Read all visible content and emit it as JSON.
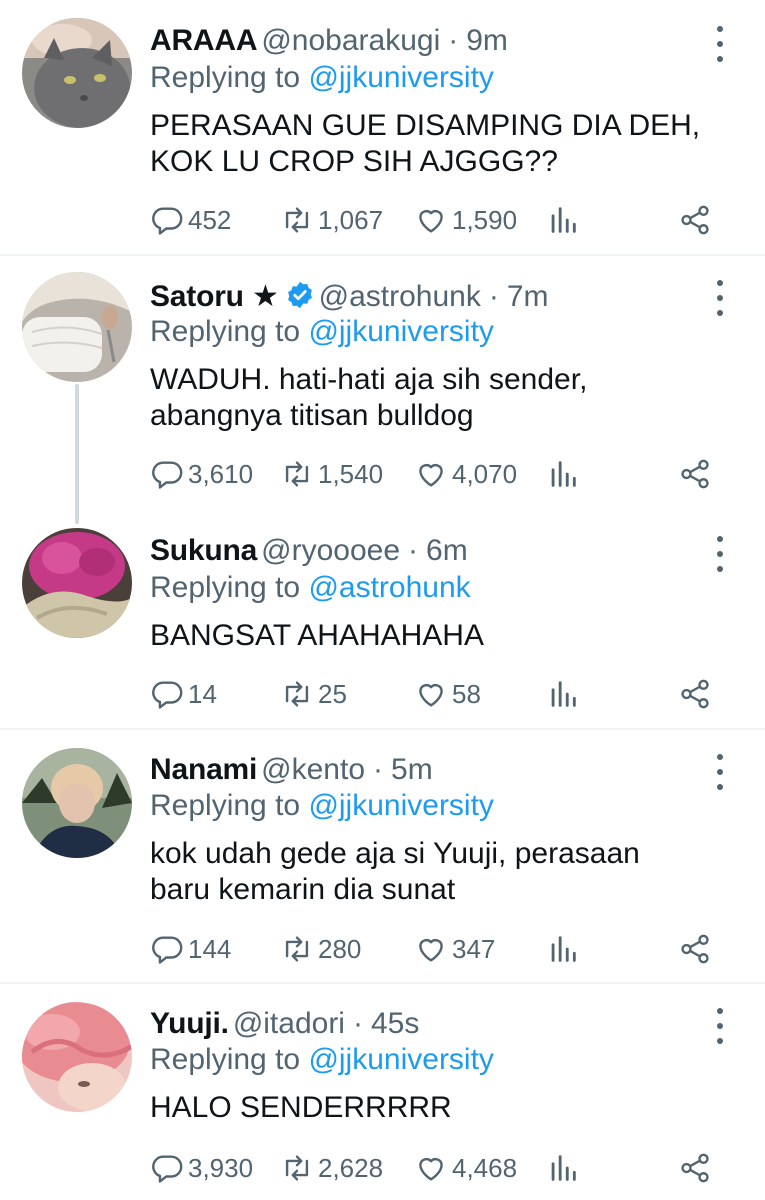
{
  "tweets": [
    {
      "name": "ARAAA",
      "handle": "@nobarakugi",
      "time": "9m",
      "reply_prefix": "Replying to",
      "reply_to": "@jjkuniversity",
      "text": "PERASAAN GUE DISAMPING DIA DEH,\nKOK LU CROP SIH AJGGG??",
      "replies": "452",
      "retweets": "1,067",
      "likes": "1,590"
    },
    {
      "name": "Satoru ★",
      "handle": "@astrohunk",
      "time": "7m",
      "reply_prefix": "Replying to",
      "reply_to": "@jjkuniversity",
      "text": "WADUH. hati-hati aja sih sender,\nabangnya titisan bulldog",
      "replies": "3,610",
      "retweets": "1,540",
      "likes": "4,070"
    },
    {
      "name": "Sukuna",
      "handle": "@ryoooee",
      "time": "6m",
      "reply_prefix": "Replying to",
      "reply_to": "@astrohunk",
      "text": "BANGSAT AHAHAHAHA",
      "replies": "14",
      "retweets": "25",
      "likes": "58"
    },
    {
      "name": "Nanami",
      "handle": "@kento",
      "time": "5m",
      "reply_prefix": "Replying to",
      "reply_to": "@jjkuniversity",
      "text": "kok udah gede aja si Yuuji, perasaan\nbaru kemarin dia sunat",
      "replies": "144",
      "retweets": "280",
      "likes": "347"
    },
    {
      "name": "Yuuji.",
      "handle": "@itadori",
      "time": "45s",
      "reply_prefix": "Replying to",
      "reply_to": "@jjkuniversity",
      "text": "HALO SENDERRRRR",
      "replies": "3,930",
      "retweets": "2,628",
      "likes": "4,468"
    }
  ],
  "colors": {
    "accent": "#1d9bf0",
    "secondary_text": "#536471",
    "primary_text": "#0f1419",
    "divider": "#eff3f4"
  },
  "icons": [
    "reply-icon",
    "retweet-icon",
    "like-icon",
    "analytics-icon",
    "share-icon",
    "more-icon",
    "verified-icon"
  ]
}
